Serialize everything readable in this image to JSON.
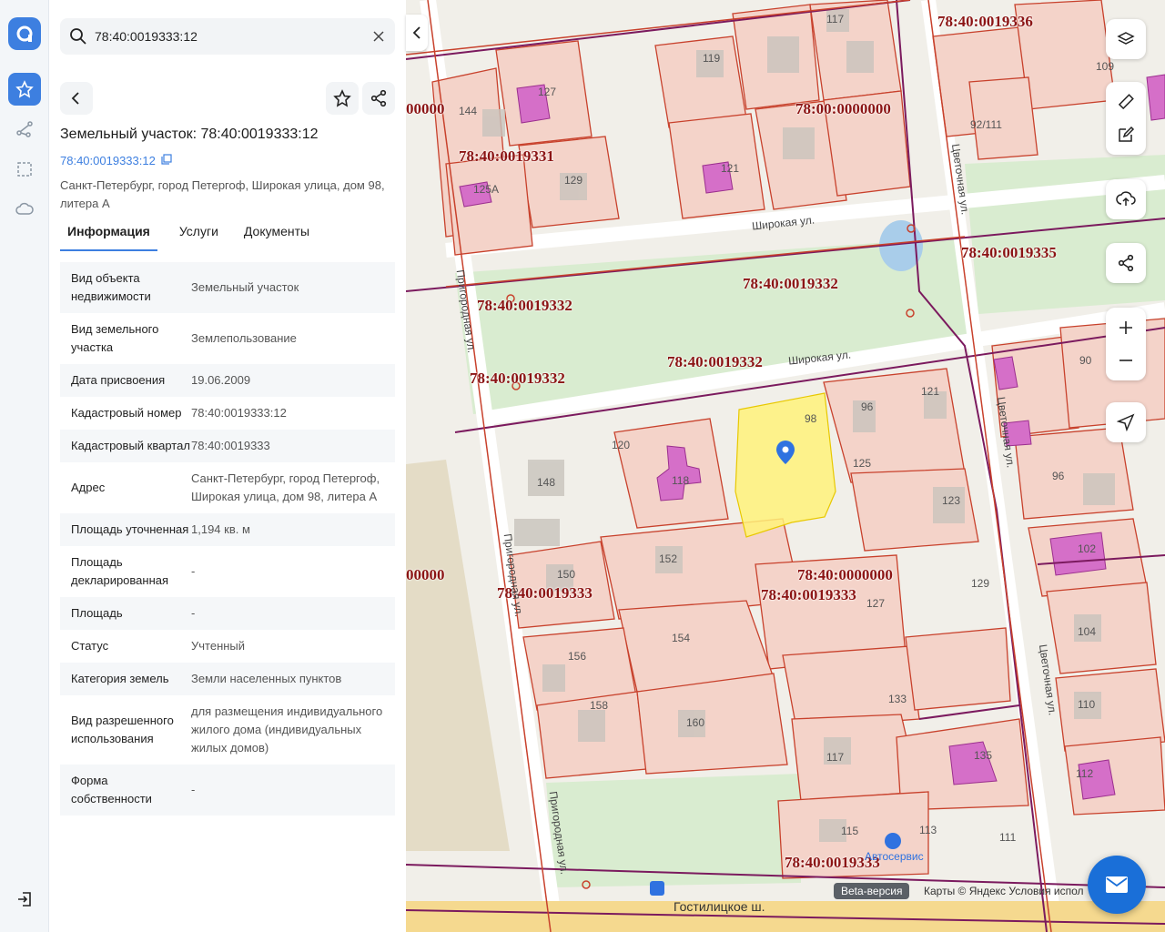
{
  "search": {
    "value": "78:40:0019333:12"
  },
  "panel": {
    "title": "Земельный участок: 78:40:0019333:12",
    "cad_link": "78:40:0019333:12",
    "address": "Санкт-Петербург, город Петергоф, Широкая улица, дом 98, литера А",
    "tabs": [
      "Информация",
      "Услуги",
      "Документы"
    ],
    "rows": [
      {
        "k": "Вид объекта недвижимости",
        "v": "Земельный участок"
      },
      {
        "k": "Вид земельного участка",
        "v": "Землепользование"
      },
      {
        "k": "Дата присвоения",
        "v": "19.06.2009"
      },
      {
        "k": "Кадастровый номер",
        "v": "78:40:0019333:12"
      },
      {
        "k": "Кадастровый квартал",
        "v": "78:40:0019333"
      },
      {
        "k": "Адрес",
        "v": "Санкт-Петербург, город Петергоф, Широкая улица, дом 98, литера А"
      },
      {
        "k": "Площадь уточненная",
        "v": "1,194 кв. м"
      },
      {
        "k": "Площадь декларированная",
        "v": "-"
      },
      {
        "k": "Площадь",
        "v": "-"
      },
      {
        "k": "Статус",
        "v": "Учтенный"
      },
      {
        "k": "Категория земель",
        "v": "Земли населенных пунктов"
      },
      {
        "k": "Вид разрешенного использования",
        "v": "для размещения индивидуального жилого дома (индивидуальных жилых домов)"
      },
      {
        "k": "Форма собственности",
        "v": "-"
      }
    ]
  },
  "map": {
    "cad_labels": [
      "78:40:0019336",
      "78:00:0000000",
      "78:40:0019331",
      "78:40:0019335",
      "78:40:0019332",
      "78:40:0019332",
      "78:40:0019332",
      "78:40:0019332",
      "78:40:0019333",
      "78:40:0000000",
      "78:40:0019333",
      "78:40:0019333",
      "00000",
      "00000"
    ],
    "house_numbers": [
      "117",
      "119",
      "127",
      "144",
      "121",
      "129",
      "125А",
      "92/111",
      "109",
      "98",
      "96",
      "121",
      "120",
      "118",
      "125",
      "123",
      "148",
      "90",
      "96",
      "152",
      "150",
      "102",
      "154",
      "156",
      "127",
      "129",
      "158",
      "160",
      "104",
      "133",
      "110",
      "117",
      "135",
      "112",
      "115",
      "113",
      "111"
    ],
    "streets": [
      "Широкая ул.",
      "Цветочная ул.",
      "Пригородная ул.",
      "Цветочная ул.",
      "Пригородная ул.",
      "Цветочная ул.",
      "Пригородная ул.",
      "Широкая ул.",
      "Гостилицкое ш."
    ],
    "poi": "Автосервис",
    "beta": "Beta-версия",
    "attribution": "Карты © Яндекс   Условия испол",
    "colors": {
      "parcel_fill": "#f4d3c9",
      "parcel_stroke": "#c8412c",
      "selected": "#fff27a",
      "building": "#d56fc8",
      "boundary": "#7b1a5e"
    }
  }
}
